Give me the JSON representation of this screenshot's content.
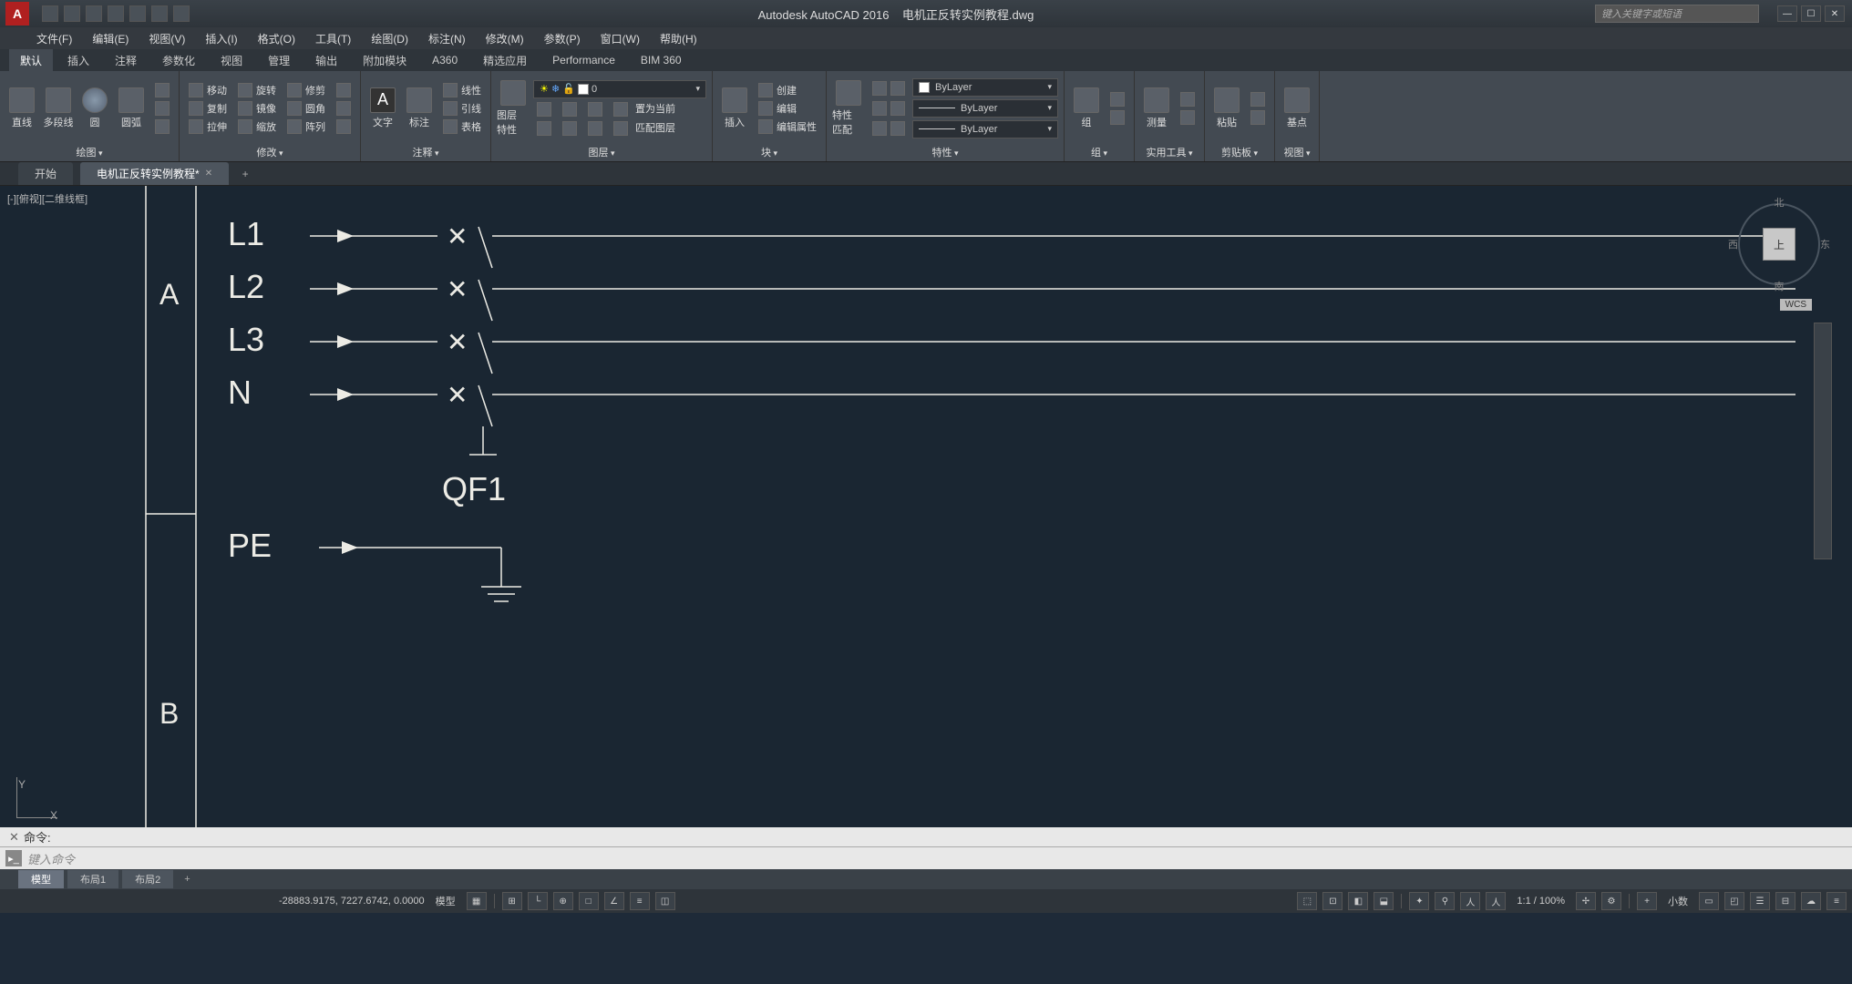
{
  "title": {
    "app": "Autodesk AutoCAD 2016",
    "file": "电机正反转实例教程.dwg"
  },
  "search_placeholder": "键入关键字或短语",
  "menus": [
    "文件(F)",
    "编辑(E)",
    "视图(V)",
    "插入(I)",
    "格式(O)",
    "工具(T)",
    "绘图(D)",
    "标注(N)",
    "修改(M)",
    "参数(P)",
    "窗口(W)",
    "帮助(H)"
  ],
  "ribbon_tabs": [
    "默认",
    "插入",
    "注释",
    "参数化",
    "视图",
    "管理",
    "输出",
    "附加模块",
    "A360",
    "精选应用",
    "Performance",
    "BIM 360"
  ],
  "panels": {
    "draw": {
      "label": "绘图",
      "btns": [
        "直线",
        "多段线",
        "圆",
        "圆弧"
      ]
    },
    "modify": {
      "label": "修改",
      "items": [
        "移动",
        "旋转",
        "修剪",
        "复制",
        "镜像",
        "圆角",
        "拉伸",
        "缩放",
        "阵列"
      ]
    },
    "annotate": {
      "label": "注释",
      "btns": [
        "文字",
        "标注"
      ],
      "items": [
        "线性",
        "引线",
        "表格"
      ]
    },
    "layers": {
      "label": "图层",
      "btn": "图层\n特性",
      "current": "0",
      "items": [
        "置为当前",
        "匹配图层"
      ]
    },
    "block": {
      "label": "块",
      "btn": "插入",
      "items": [
        "创建",
        "编辑",
        "编辑属性"
      ]
    },
    "properties": {
      "label": "特性",
      "btn": "特性\n匹配",
      "bylayer": "ByLayer"
    },
    "group": {
      "label": "组",
      "btn": "组"
    },
    "utils": {
      "label": "实用工具",
      "btn": "测量"
    },
    "clipboard": {
      "label": "剪贴板",
      "btn": "粘贴"
    },
    "view": {
      "label": "视图",
      "btn": "基点"
    }
  },
  "doc_tabs": {
    "start": "开始",
    "active": "电机正反转实例教程*"
  },
  "viewport_label": "[-][俯视][二维线框]",
  "viewcube": {
    "face": "上",
    "n": "北",
    "s": "南",
    "w": "西",
    "e": "东",
    "wcs": "WCS"
  },
  "drawing": {
    "row_label_A": "A",
    "row_label_B": "B",
    "lines": [
      "L1",
      "L2",
      "L3",
      "N"
    ],
    "pe": "PE",
    "breaker": "QF1"
  },
  "ucs": {
    "x": "X",
    "y": "Y"
  },
  "command": {
    "prompt": "命令:",
    "placeholder": "键入命令"
  },
  "layout_tabs": {
    "model": "模型",
    "l1": "布局1",
    "l2": "布局2"
  },
  "statusbar": {
    "coords": "-28883.9175, 7227.6742, 0.0000",
    "model": "模型",
    "scale": "1:1 / 100%",
    "decimal": "小数"
  }
}
